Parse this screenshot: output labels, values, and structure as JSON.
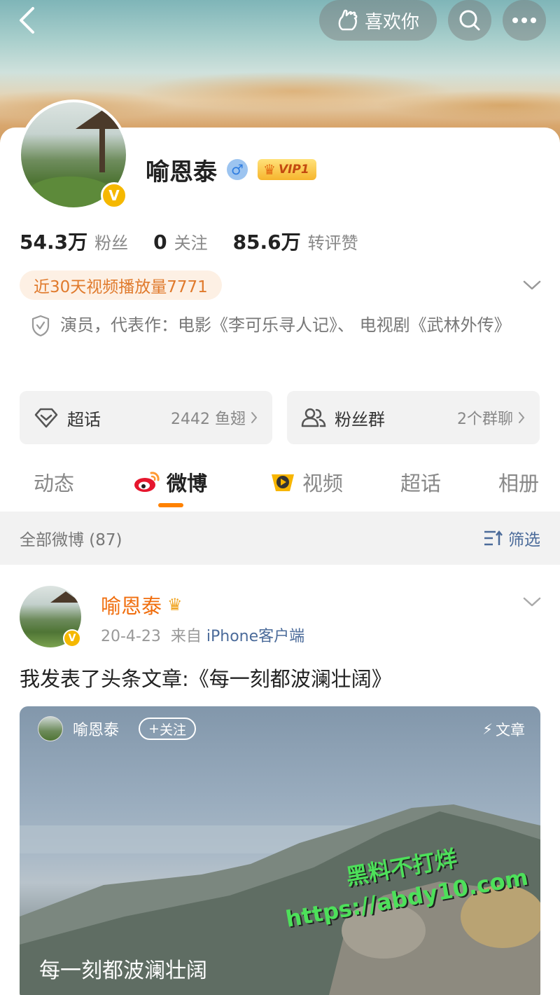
{
  "header": {
    "like_label": "喜欢你",
    "icons": [
      "back-icon",
      "like-icon",
      "search-icon",
      "more-icon"
    ]
  },
  "profile": {
    "name": "喻恩泰",
    "gender": "♂",
    "vip_label": "VIP1",
    "verified_mark": "V",
    "stats": [
      {
        "value": "54.3万",
        "label": "粉丝"
      },
      {
        "value": "0",
        "label": "关注"
      },
      {
        "value": "85.6万",
        "label": "转评赞"
      }
    ],
    "play_tag": "近30天视频播放量7771",
    "bio": "演员，代表作：电影《李可乐寻人记》、 电视剧《武林外传》"
  },
  "chips": {
    "topic": {
      "title": "超话",
      "meta": "2442 鱼翅"
    },
    "fans": {
      "title": "粉丝群",
      "meta": "2个群聊"
    }
  },
  "tabs": [
    {
      "label": "动态",
      "active": false
    },
    {
      "label": "微博",
      "active": true
    },
    {
      "label": "视频",
      "active": false
    },
    {
      "label": "超话",
      "active": false
    },
    {
      "label": "相册",
      "active": false
    }
  ],
  "filter": {
    "count_label": "全部微博 (87)",
    "filter_label": "筛选"
  },
  "post": {
    "author": "喻恩泰",
    "date": "20-4-23",
    "from_label": "来自",
    "source": "iPhone客户端",
    "text": "我发表了头条文章:《每一刻都波澜壮阔》",
    "article": {
      "author": "喻恩泰",
      "follow_label": "关注",
      "tag": "文章",
      "title": "每一刻都波澜壮阔"
    }
  },
  "watermark": {
    "line1": "黑料不打烊",
    "line2": "https://abdy10.com"
  },
  "colors": {
    "accent": "#ff8200",
    "name_orange": "#f06e0e",
    "link_blue": "#4b6b9a",
    "verified_gold": "#f5b800"
  }
}
